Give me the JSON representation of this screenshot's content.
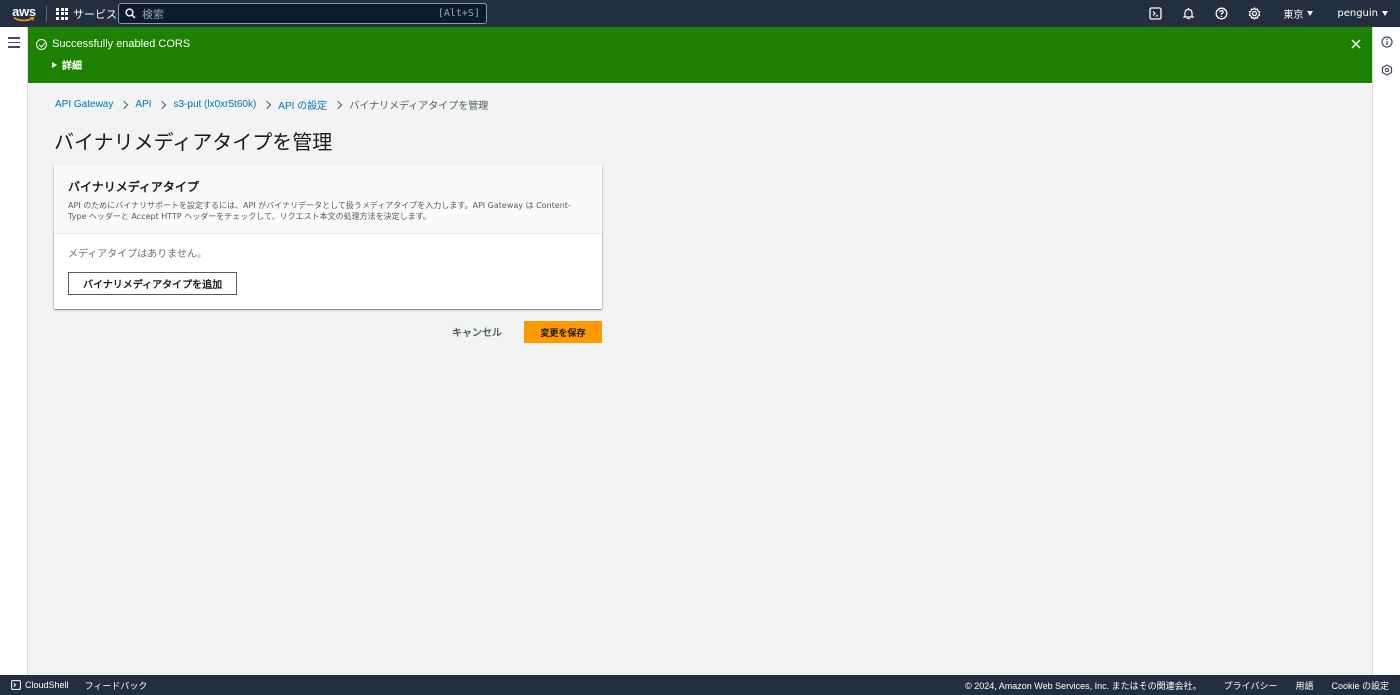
{
  "topnav": {
    "logo_text": "aws",
    "services_label": "サービス",
    "search_placeholder": "検索",
    "search_shortcut": "[Alt+S]",
    "region_label": "東京",
    "user_label": "penguin"
  },
  "flash": {
    "message": "Successfully enabled CORS",
    "details_label": "詳細",
    "color": "#1d8102"
  },
  "breadcrumb": {
    "items": [
      "API Gateway",
      "API",
      "s3-put (lx0xr5t60k)",
      "API の設定"
    ],
    "current": "バイナリメディアタイプを管理"
  },
  "page_title": "バイナリメディアタイプを管理",
  "panel": {
    "title": "バイナリメディアタイプ",
    "description": "API のためにバイナリサポートを設定するには、API がバイナリデータとして扱うメディアタイプを入力します。API Gateway は Content-Type ヘッダーと Accept HTTP ヘッダーをチェックして、リクエスト本文の処理方法を決定します。",
    "empty_text": "メディアタイプはありません。",
    "add_button": "バイナリメディアタイプを追加"
  },
  "actions": {
    "cancel": "キャンセル",
    "save": "変更を保存",
    "accent": "#ff9900"
  },
  "footer": {
    "cloudshell": "CloudShell",
    "feedback": "フィードバック",
    "copyright": "© 2024, Amazon Web Services, Inc. またはその関連会社。",
    "privacy": "プライバシー",
    "terms": "用語",
    "cookie": "Cookie の設定"
  }
}
